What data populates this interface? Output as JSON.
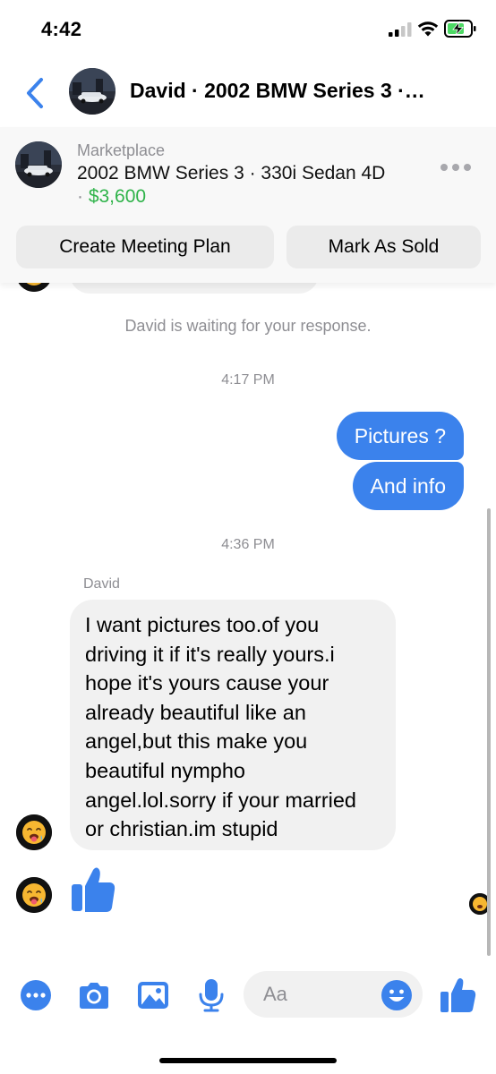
{
  "status_bar": {
    "time": "4:42",
    "icons": [
      "cellular-signal-icon",
      "wifi-icon",
      "battery-charging-icon"
    ]
  },
  "header": {
    "back_icon": "chevron-left-icon",
    "title": "David · 2002 BMW Series 3 ·…"
  },
  "marketplace": {
    "label": "Marketplace",
    "item": "2002 BMW Series 3 · 330i Sedan 4D",
    "price_prefix": "· ",
    "price": "$3,600",
    "more_icon": "more-horizontal-icon",
    "buttons": {
      "meeting": "Create Meeting Plan",
      "sold": "Mark As Sold"
    }
  },
  "chat": {
    "system_message": "David is waiting for your response.",
    "timestamps": [
      "4:17 PM",
      "4:36 PM"
    ],
    "outgoing": [
      "Pictures ?",
      "And info"
    ],
    "sender_name": "David",
    "incoming_lines": [
      "I want pictures too.of you",
      "driving it if it's really yours.i",
      "hope it's yours cause your",
      "already beautiful like an",
      "angel,but this make you",
      "beautiful nympho",
      "angel.lol.sorry if your married",
      "or christian.im  stupid"
    ],
    "sticker": "thumbs-up-sticker",
    "avatar_emoji": "drooling-face-emoji"
  },
  "composer": {
    "placeholder": "Aa",
    "tools": [
      "more-icon",
      "camera-icon",
      "gallery-icon",
      "microphone-icon"
    ],
    "emoji_icon": "smiley-icon",
    "send_icon": "thumbs-up-icon"
  },
  "colors": {
    "accent": "#3b82ec",
    "price_green": "#2fb34a",
    "bubble_in": "#f1f1f1",
    "muted_text": "#8e8e93"
  }
}
